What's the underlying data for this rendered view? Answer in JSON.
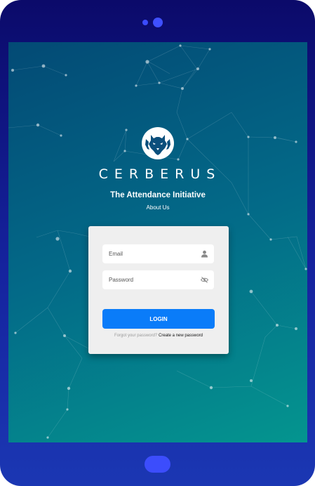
{
  "brand": {
    "name": "CERBERUS",
    "tagline": "The Attendance Initiative",
    "about_link": "About Us"
  },
  "login_form": {
    "email_placeholder": "Email",
    "password_placeholder": "Password",
    "login_label": "LOGIN",
    "forgot_text": "Forgot your password?",
    "create_link": "Create a new password"
  },
  "icons": {
    "email": "user-icon",
    "password": "eye-slash-icon",
    "logo": "three-headed-dog-icon"
  },
  "colors": {
    "device_frame": "#0b0a6a",
    "accent_dots": "#3c4dfc",
    "screen_top": "#034a75",
    "screen_bottom": "#04958f",
    "login_button": "#0a7cf9",
    "card": "#efefef"
  }
}
